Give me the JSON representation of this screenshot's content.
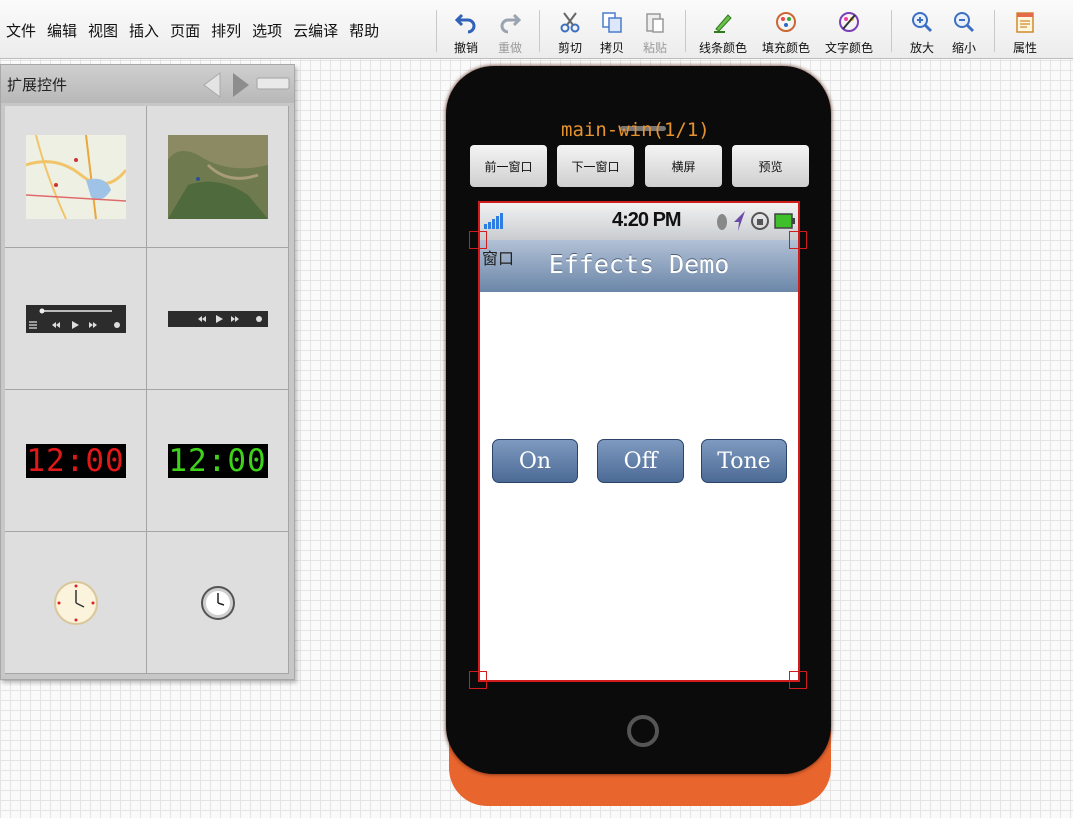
{
  "menu": [
    "文件",
    "编辑",
    "视图",
    "插入",
    "页面",
    "排列",
    "选项",
    "云编译",
    "帮助"
  ],
  "toolbar": {
    "undo": "撤销",
    "redo": "重做",
    "cut": "剪切",
    "copy": "拷贝",
    "paste": "粘贴",
    "line_color": "线条颜色",
    "fill_color": "填充颜色",
    "text_color": "文字颜色",
    "zoom_in": "放大",
    "zoom_out": "缩小",
    "properties": "属性"
  },
  "panel": {
    "title": "扩展控件",
    "clock_red": "12:00",
    "clock_green": "12:00"
  },
  "phone": {
    "title": "main-win(1/1)",
    "buttons": [
      "前一窗口",
      "下一窗口",
      "横屏",
      "预览"
    ],
    "status_time": "4:20 PM",
    "window_label": "窗口",
    "nav_title": "Effects Demo",
    "effect_buttons": [
      "On",
      "Off",
      "Tone"
    ]
  },
  "colors": {
    "accent_orange": "#e8652e",
    "selection_red": "#d21c1c",
    "nav_blue": "#6b86a8"
  }
}
